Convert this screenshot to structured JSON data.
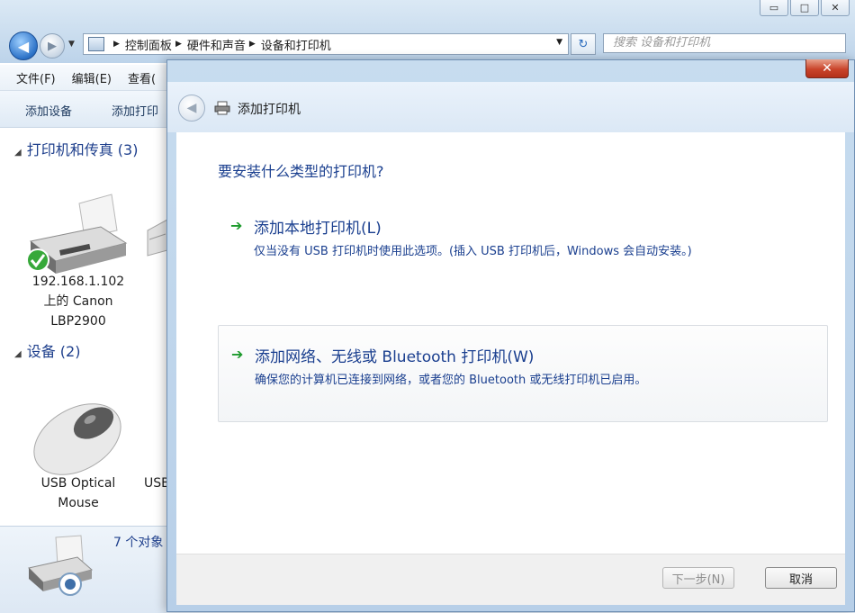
{
  "explorer": {
    "breadcrumb": [
      "控制面板",
      "硬件和声音",
      "设备和打印机"
    ],
    "search_placeholder": "搜索 设备和打印机",
    "menu": [
      "文件(F)",
      "编辑(E)",
      "查看("
    ],
    "toolbar": {
      "add_device": "添加设备",
      "add_printer": "添加打印"
    },
    "groups": [
      {
        "title": "打印机和传真 (3)",
        "items": [
          {
            "label_lines": [
              "192.168.1.102",
              "上的 Canon",
              "LBP2900"
            ]
          }
        ]
      },
      {
        "title": "设备 (2)",
        "items": [
          {
            "label_lines": [
              "USB Optical",
              "Mouse"
            ]
          },
          {
            "label_lines": [
              "USB"
            ]
          }
        ]
      }
    ],
    "status_count": "7 个对象"
  },
  "dialog": {
    "title": "添加打印机",
    "question": "要安装什么类型的打印机?",
    "options": [
      {
        "title": "添加本地打印机(L)",
        "description": "仅当没有 USB 打印机时使用此选项。(插入 USB 打印机后，Windows 会自动安装。)"
      },
      {
        "title": "添加网络、无线或 Bluetooth 打印机(W)",
        "description": "确保您的计算机已连接到网络，或者您的 Bluetooth 或无线打印机已启用。"
      }
    ],
    "next_label": "下一步(N)",
    "cancel_label": "取消"
  },
  "colors": {
    "link_blue": "#1a3f8f",
    "arrow_green": "#1d9a2c",
    "close_red": "#c9442a"
  }
}
